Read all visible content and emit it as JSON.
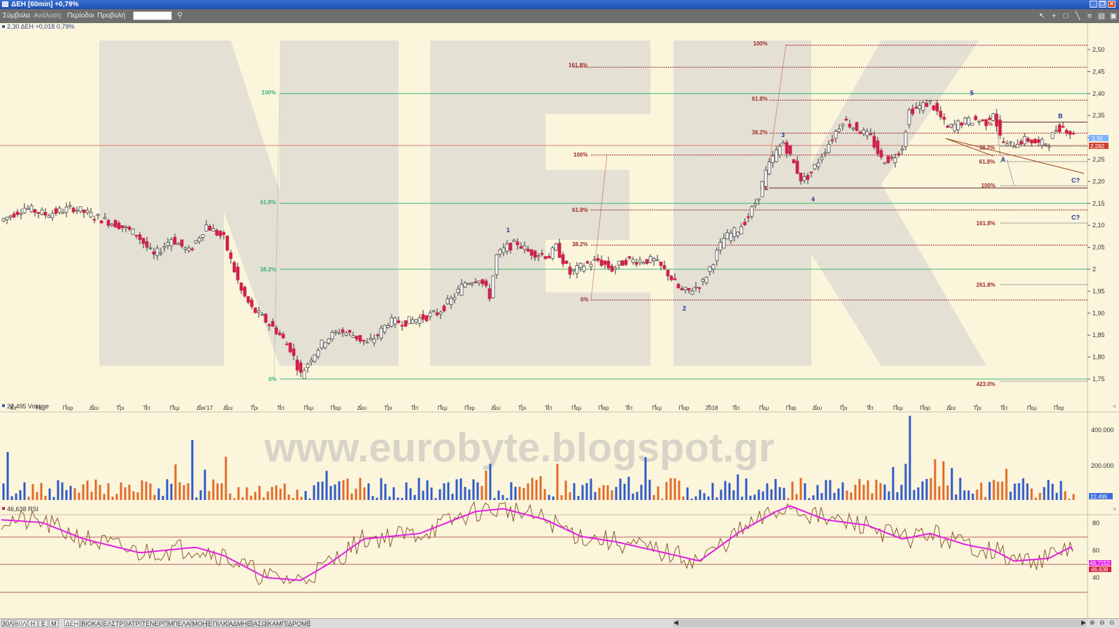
{
  "window": {
    "title": "ΔΕΗ [60min] +0,79%"
  },
  "menu": {
    "items": [
      "Σύμβολα",
      "Ανάλυση",
      "Περίοδοι",
      "Προβολή"
    ]
  },
  "panes": {
    "price_header": "2,30 ΔΕΗ +0,018 0,79%",
    "volume_header": "22.495 Volume",
    "rsi_header": "46,638 RSI"
  },
  "price_axis": {
    "ticks": [
      "2,50",
      "2,45",
      "2,40",
      "2,35",
      "2,30",
      "2,25",
      "2,20",
      "2,15",
      "2,10",
      "2,05",
      "2",
      "1,95",
      "1,90",
      "1,85",
      "1,80",
      "1,75"
    ],
    "current_label": "2,30",
    "current_line_label": "2,282"
  },
  "x_axis": {
    "labels": [
      "Τετ",
      "Πεμ",
      "Παρ",
      "Δευ",
      "Τρι",
      "Τετ",
      "Πεμ",
      "Δεκ'17",
      "Δευ",
      "Τρι",
      "Τετ",
      "Πεμ",
      "Παρ",
      "Δευ",
      "Τρι",
      "Τετ",
      "Πεμ",
      "Παρ",
      "Δευ",
      "Τρι",
      "Τετ",
      "Πεμ",
      "Παρ",
      "Τετ",
      "Πεμ",
      "Παρ",
      "2018",
      "Τετ",
      "Πεμ",
      "Παρ",
      "Δευ",
      "Τρι",
      "Τετ",
      "Πεμ",
      "Παρ",
      "Δευ",
      "Τρι",
      "Τετ",
      "Πεμ",
      "Παρ"
    ]
  },
  "volume_axis": {
    "ticks": [
      "400.000",
      "200.000"
    ],
    "current_label": "22.495"
  },
  "rsi_axis": {
    "ticks": [
      "80",
      "60",
      "40"
    ],
    "label_a": "49,7152",
    "label_b": "46,638"
  },
  "fib_green": {
    "labels": [
      "100%",
      "61.8%",
      "38.2%",
      "0%"
    ]
  },
  "fib_mid": {
    "labels": [
      "100%",
      "61.8%",
      "38.2%",
      "0%"
    ]
  },
  "fib_top": {
    "labels": [
      "100%",
      "161.8%",
      "61.8%",
      "38.2%"
    ]
  },
  "fib_right": {
    "labels": [
      "38.2%",
      "61.8%",
      "100%",
      "161.8%",
      "261.8%",
      "423.0%"
    ]
  },
  "fib_small": {
    "labels": [
      "0%",
      "0%"
    ]
  },
  "waves": {
    "labels": [
      "1",
      "2",
      "3",
      "4",
      "5",
      "A",
      "B",
      "C?",
      "C?"
    ]
  },
  "watermark": {
    "letters": "NEK",
    "url": "www.eurobyte.blogspot.gr"
  },
  "bottom_tabs": [
    "30Λ",
    "60Λ",
    "Η",
    "Ε",
    "Μ",
    "ΔΕΗ",
    "ΒΙΟΚΑ",
    "ΕΛΣΤΡ",
    "ΙΑΤΡ",
    "ΤΕΝΕΡΓ",
    "ΜΠΕΛΑ",
    "ΜΟΗ",
    "ΕΠΙΛΚ",
    "ΑΔΜΗΕ",
    "ΙΑΣΩ",
    "ΚΑΜΠ",
    "ΔΡΟΜΕ"
  ],
  "colors": {
    "bull": "#ffffff",
    "bear": "#d0204a",
    "vol_blue": "#2f59c8",
    "vol_orange": "#e06a28",
    "rsi": "#e020e0",
    "fib_green": "#3cb371",
    "fib_red": "#9b2a2a"
  }
}
